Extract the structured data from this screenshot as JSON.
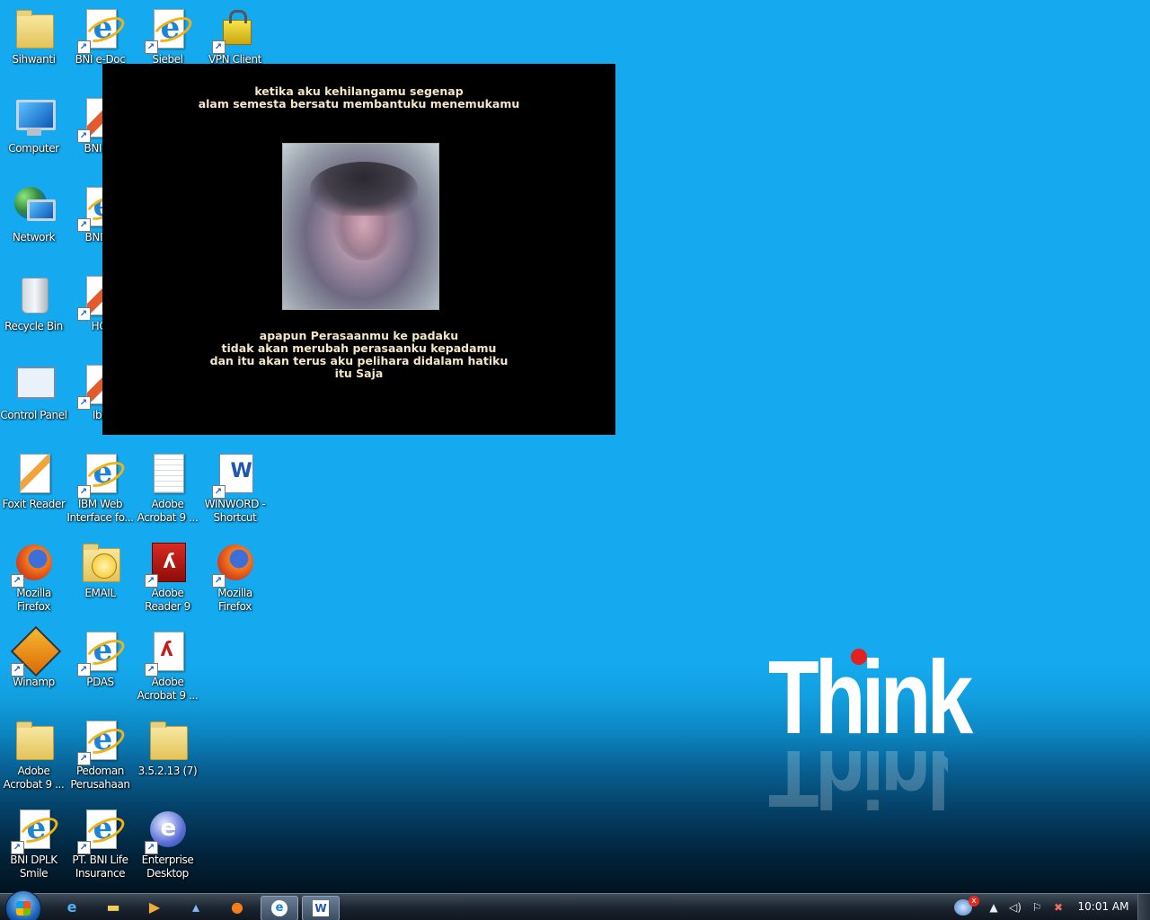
{
  "desktop": {
    "icons": [
      {
        "label": "Sihwanti",
        "type": "folder"
      },
      {
        "label": "BNI e-Doc",
        "type": "ie"
      },
      {
        "label": "Siebel",
        "type": "ie"
      },
      {
        "label": "VPN Client",
        "type": "padlock"
      },
      {
        "label": "Computer",
        "type": "computer"
      },
      {
        "label": "BNI Fo",
        "type": "app"
      },
      {
        "label": "Network",
        "type": "network"
      },
      {
        "label": "BNI iC",
        "type": "ie"
      },
      {
        "label": "Recycle Bin",
        "type": "recycle-bin"
      },
      {
        "label": "HCI",
        "type": "app"
      },
      {
        "label": "Control Panel",
        "type": "control-panel"
      },
      {
        "label": "Iba",
        "type": "app"
      },
      {
        "label": "Foxit Reader",
        "type": "foxit"
      },
      {
        "label": "IBM Web Interface fo...",
        "type": "ie"
      },
      {
        "label": "Adobe Acrobat 9 ...",
        "type": "document"
      },
      {
        "label": "WINWORD - Shortcut",
        "type": "word"
      },
      {
        "label": "Mozilla Firefox",
        "type": "firefox"
      },
      {
        "label": "EMAIL",
        "type": "email"
      },
      {
        "label": "Adobe Reader 9",
        "type": "acrobat"
      },
      {
        "label": "Mozilla Firefox",
        "type": "firefox"
      },
      {
        "label": "Winamp",
        "type": "winamp"
      },
      {
        "label": "PDAS",
        "type": "ie"
      },
      {
        "label": "Adobe Acrobat 9 ...",
        "type": "pdf"
      },
      {
        "label": "Adobe Acrobat 9 ...",
        "type": "folder"
      },
      {
        "label": "Pedoman Perusahaan",
        "type": "ie"
      },
      {
        "label": "3.5.2.13 (7)",
        "type": "folder"
      },
      {
        "label": "BNI DPLK Smile",
        "type": "ie"
      },
      {
        "label": "PT. BNI Life Insurance",
        "type": "ie"
      },
      {
        "label": "Enterprise Desktop",
        "type": "enterprise"
      }
    ]
  },
  "popup": {
    "verse_top": "ketika aku kehilangamu segenap\nalam semesta bersatu membantuku menemukamu",
    "verse_bottom": "apapun Perasaanmu ke padaku\ntidak akan merubah perasaanku kepadamu\ndan itu akan terus aku pelihara didalam hatiku\nitu Saja"
  },
  "wallpaper": {
    "logo_text": "Think",
    "logo_dot_color": "#e3211e"
  },
  "taskbar": {
    "pinned": [
      "internet-explorer-icon",
      "explorer-folder-icon",
      "media-player-icon",
      "app-icon",
      "firefox-icon",
      "ie-window-icon",
      "word-window-icon"
    ],
    "clock": "10:01 AM"
  },
  "colors": {
    "desktop_blue": "#15aaef",
    "popup_bg": "#000000",
    "verse_text": "#f5e6c8"
  }
}
